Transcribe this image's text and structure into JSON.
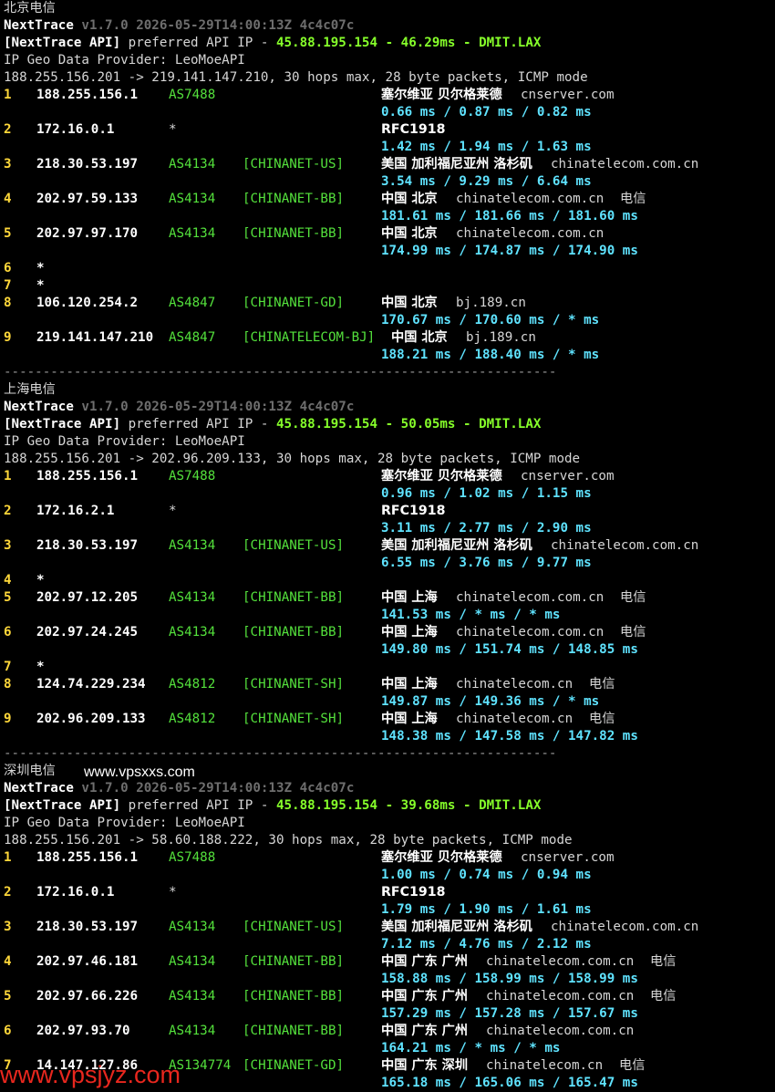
{
  "blocks": [
    {
      "heading": "北京电信",
      "app_name": "NextTrace",
      "version_line": "v1.7.0 2026-05-29T14:00:13Z 4c4c07c",
      "api_tag": "[NextTrace API]",
      "api_mid": "preferred API IP -",
      "api_ip": "45.88.195.154",
      "api_dash1": "-",
      "api_latency": "46.29ms",
      "api_dash2": "-",
      "api_node": "DMIT.LAX",
      "geo_provider": "IP Geo Data Provider: LeoMoeAPI",
      "trace_header": "188.255.156.201 -> 219.141.147.210, 30 hops max, 28 byte packets, ICMP mode",
      "hops": [
        {
          "n": "1",
          "ip": "188.255.156.1",
          "asn": "AS7488",
          "tag": "",
          "loc": "塞尔维亚 贝尔格莱德",
          "domain": "cnserver.com",
          "isp": "",
          "rtt": "0.66 ms / 0.87 ms / 0.82 ms"
        },
        {
          "n": "2",
          "ip": "172.16.0.1",
          "asn": "*",
          "tag": "",
          "loc": "RFC1918",
          "domain": "",
          "isp": "",
          "rtt": "1.42 ms / 1.94 ms / 1.63 ms"
        },
        {
          "n": "3",
          "ip": "218.30.53.197",
          "asn": "AS4134",
          "tag": "[CHINANET-US]",
          "loc": "美国 加利福尼亚州 洛杉矶",
          "domain": "chinatelecom.com.cn",
          "isp": "",
          "rtt": "3.54 ms / 9.29 ms / 6.64 ms"
        },
        {
          "n": "4",
          "ip": "202.97.59.133",
          "asn": "AS4134",
          "tag": "[CHINANET-BB]",
          "loc": "中国 北京",
          "domain": "chinatelecom.com.cn",
          "isp": "电信",
          "rtt": "181.61 ms / 181.66 ms / 181.60 ms"
        },
        {
          "n": "5",
          "ip": "202.97.97.170",
          "asn": "AS4134",
          "tag": "[CHINANET-BB]",
          "loc": "中国 北京",
          "domain": "chinatelecom.com.cn",
          "isp": "",
          "rtt": "174.99 ms / 174.87 ms / 174.90 ms"
        },
        {
          "n": "6",
          "ip": "*",
          "timeout": true
        },
        {
          "n": "7",
          "ip": "*",
          "timeout": true
        },
        {
          "n": "8",
          "ip": "106.120.254.2",
          "asn": "AS4847",
          "tag": "[CHINANET-GD]",
          "loc": "中国 北京",
          "domain": "bj.189.cn",
          "isp": "",
          "rtt": "170.67 ms / 170.60 ms / * ms"
        },
        {
          "n": "9",
          "ip": "219.141.147.210",
          "asn": "AS4847",
          "tag": "[CHINATELECOM-BJ]",
          "loc": "中国 北京",
          "domain": "bj.189.cn",
          "isp": "",
          "rtt": "188.21 ms / 188.40 ms / * ms",
          "shift": true
        }
      ],
      "separator": "-----------------------------------------------------------------------"
    },
    {
      "heading": "上海电信",
      "app_name": "NextTrace",
      "version_line": "v1.7.0 2026-05-29T14:00:13Z 4c4c07c",
      "api_tag": "[NextTrace API]",
      "api_mid": "preferred API IP -",
      "api_ip": "45.88.195.154",
      "api_dash1": "-",
      "api_latency": "50.05ms",
      "api_dash2": "-",
      "api_node": "DMIT.LAX",
      "geo_provider": "IP Geo Data Provider: LeoMoeAPI",
      "trace_header": "188.255.156.201 -> 202.96.209.133, 30 hops max, 28 byte packets, ICMP mode",
      "hops": [
        {
          "n": "1",
          "ip": "188.255.156.1",
          "asn": "AS7488",
          "tag": "",
          "loc": "塞尔维亚 贝尔格莱德",
          "domain": "cnserver.com",
          "isp": "",
          "rtt": "0.96 ms / 1.02 ms / 1.15 ms"
        },
        {
          "n": "2",
          "ip": "172.16.2.1",
          "asn": "*",
          "tag": "",
          "loc": "RFC1918",
          "domain": "",
          "isp": "",
          "rtt": "3.11 ms / 2.77 ms / 2.90 ms"
        },
        {
          "n": "3",
          "ip": "218.30.53.197",
          "asn": "AS4134",
          "tag": "[CHINANET-US]",
          "loc": "美国 加利福尼亚州 洛杉矶",
          "domain": "chinatelecom.com.cn",
          "isp": "",
          "rtt": "6.55 ms / 3.76 ms / 9.77 ms"
        },
        {
          "n": "4",
          "ip": "*",
          "timeout": true
        },
        {
          "n": "5",
          "ip": "202.97.12.205",
          "asn": "AS4134",
          "tag": "[CHINANET-BB]",
          "loc": "中国 上海",
          "domain": "chinatelecom.com.cn",
          "isp": "电信",
          "rtt": "141.53 ms / * ms / * ms"
        },
        {
          "n": "6",
          "ip": "202.97.24.245",
          "asn": "AS4134",
          "tag": "[CHINANET-BB]",
          "loc": "中国 上海",
          "domain": "chinatelecom.com.cn",
          "isp": "电信",
          "rtt": "149.80 ms / 151.74 ms / 148.85 ms"
        },
        {
          "n": "7",
          "ip": "*",
          "timeout": true
        },
        {
          "n": "8",
          "ip": "124.74.229.234",
          "asn": "AS4812",
          "tag": "[CHINANET-SH]",
          "loc": "中国 上海",
          "domain": "chinatelecom.cn",
          "isp": "电信",
          "rtt": "149.87 ms / 149.36 ms / * ms"
        },
        {
          "n": "9",
          "ip": "202.96.209.133",
          "asn": "AS4812",
          "tag": "[CHINANET-SH]",
          "loc": "中国 上海",
          "domain": "chinatelecom.cn",
          "isp": "电信",
          "rtt": "148.38 ms / 147.58 ms / 147.82 ms"
        }
      ],
      "separator": "-----------------------------------------------------------------------"
    },
    {
      "heading": "深圳电信",
      "app_name": "NextTrace",
      "version_line": "v1.7.0 2026-05-29T14:00:13Z 4c4c07c",
      "api_tag": "[NextTrace API]",
      "api_mid": "preferred API IP -",
      "api_ip": "45.88.195.154",
      "api_dash1": "-",
      "api_latency": "39.68ms",
      "api_dash2": "-",
      "api_node": "DMIT.LAX",
      "geo_provider": "IP Geo Data Provider: LeoMoeAPI",
      "trace_header": "188.255.156.201 -> 58.60.188.222, 30 hops max, 28 byte packets, ICMP mode",
      "hops": [
        {
          "n": "1",
          "ip": "188.255.156.1",
          "asn": "AS7488",
          "tag": "",
          "loc": "塞尔维亚 贝尔格莱德",
          "domain": "cnserver.com",
          "isp": "",
          "rtt": "1.00 ms / 0.74 ms / 0.94 ms"
        },
        {
          "n": "2",
          "ip": "172.16.0.1",
          "asn": "*",
          "tag": "",
          "loc": "RFC1918",
          "domain": "",
          "isp": "",
          "rtt": "1.79 ms / 1.90 ms / 1.61 ms"
        },
        {
          "n": "3",
          "ip": "218.30.53.197",
          "asn": "AS4134",
          "tag": "[CHINANET-US]",
          "loc": "美国 加利福尼亚州 洛杉矶",
          "domain": "chinatelecom.com.cn",
          "isp": "",
          "rtt": "7.12 ms / 4.76 ms / 2.12 ms"
        },
        {
          "n": "4",
          "ip": "202.97.46.181",
          "asn": "AS4134",
          "tag": "[CHINANET-BB]",
          "loc": "中国 广东 广州",
          "domain": "chinatelecom.com.cn",
          "isp": "电信",
          "rtt": "158.88 ms / 158.99 ms / 158.99 ms"
        },
        {
          "n": "5",
          "ip": "202.97.66.226",
          "asn": "AS4134",
          "tag": "[CHINANET-BB]",
          "loc": "中国 广东 广州",
          "domain": "chinatelecom.com.cn",
          "isp": "电信",
          "rtt": "157.29 ms / 157.28 ms / 157.67 ms"
        },
        {
          "n": "6",
          "ip": "202.97.93.70",
          "asn": "AS4134",
          "tag": "[CHINANET-BB]",
          "loc": "中国 广东 广州",
          "domain": "chinatelecom.com.cn",
          "isp": "",
          "rtt": "164.21 ms / * ms / * ms"
        },
        {
          "n": "7",
          "ip": "14.147.127.86",
          "asn": "AS134774",
          "tag": "[CHINANET-GD]",
          "loc": "中国 广东 深圳",
          "domain": "chinatelecom.cn",
          "isp": "电信",
          "rtt": "165.18 ms / 165.06 ms / 165.47 ms"
        }
      ],
      "separator": ""
    }
  ],
  "watermark_top": "www.vpsxxs.com",
  "watermark_bottom": "www.vpsjyz.com",
  "colors": {
    "background": "#000000",
    "hop_number": "#ffd83a",
    "asn": "#54e13c",
    "rtt": "#5fe3ff",
    "api_highlight": "#86ff2a",
    "watermark_bottom": "#e8271e"
  }
}
